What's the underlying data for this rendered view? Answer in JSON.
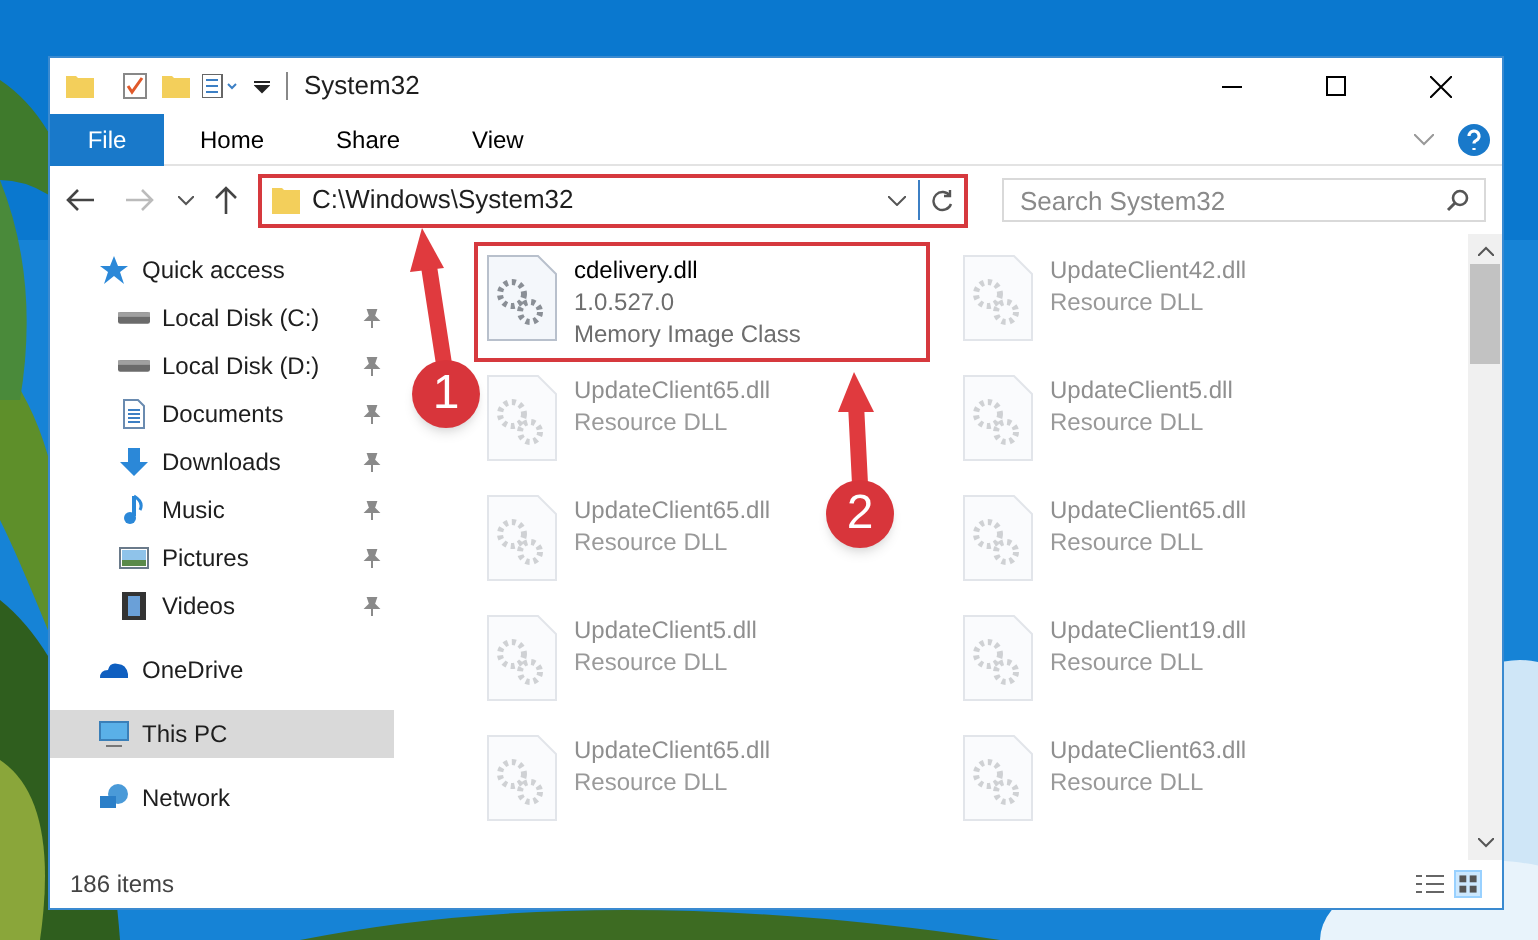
{
  "window": {
    "title": "System32"
  },
  "ribbon": {
    "tabs": [
      {
        "label": "File",
        "selected": true
      },
      {
        "label": "Home",
        "selected": false
      },
      {
        "label": "Share",
        "selected": false
      },
      {
        "label": "View",
        "selected": false
      }
    ]
  },
  "address": {
    "path": "C:\\Windows\\System32",
    "search_placeholder": "Search System32"
  },
  "nav": [
    {
      "label": "Quick access",
      "kind": "star",
      "selected": false,
      "pinned": false,
      "children": [
        {
          "label": "Local Disk (C:)",
          "kind": "drive",
          "selected": false,
          "pinned": true
        },
        {
          "label": "Local Disk (D:)",
          "kind": "drive",
          "selected": false,
          "pinned": true
        },
        {
          "label": "Documents",
          "kind": "document",
          "selected": false,
          "pinned": true
        },
        {
          "label": "Downloads",
          "kind": "download",
          "selected": false,
          "pinned": true
        },
        {
          "label": "Music",
          "kind": "music",
          "selected": false,
          "pinned": true
        },
        {
          "label": "Pictures",
          "kind": "pictures",
          "selected": false,
          "pinned": true
        },
        {
          "label": "Videos",
          "kind": "videos",
          "selected": false,
          "pinned": true
        }
      ]
    },
    {
      "label": "OneDrive",
      "kind": "cloud",
      "selected": false,
      "pinned": false
    },
    {
      "label": "This PC",
      "kind": "pc",
      "selected": true,
      "pinned": false
    },
    {
      "label": "Network",
      "kind": "network",
      "selected": false,
      "pinned": false
    }
  ],
  "files": [
    {
      "name": "cdelivery.dll",
      "lines": [
        "1.0.527.0",
        "Memory Image Class"
      ],
      "highlighted": true,
      "faded": false
    },
    {
      "name": "UpdateClient42.dll",
      "lines": [
        "Resource DLL"
      ],
      "highlighted": false,
      "faded": true
    },
    {
      "name": "UpdateClient65.dll",
      "lines": [
        "Resource DLL"
      ],
      "highlighted": false,
      "faded": true
    },
    {
      "name": "UpdateClient5.dll",
      "lines": [
        "Resource DLL"
      ],
      "highlighted": false,
      "faded": true
    },
    {
      "name": "UpdateClient65.dll",
      "lines": [
        "Resource DLL"
      ],
      "highlighted": false,
      "faded": true
    },
    {
      "name": "UpdateClient65.dll",
      "lines": [
        "Resource DLL"
      ],
      "highlighted": false,
      "faded": true
    },
    {
      "name": "UpdateClient5.dll",
      "lines": [
        "Resource DLL"
      ],
      "highlighted": false,
      "faded": true
    },
    {
      "name": "UpdateClient19.dll",
      "lines": [
        "Resource DLL"
      ],
      "highlighted": false,
      "faded": true
    },
    {
      "name": "UpdateClient65.dll",
      "lines": [
        "Resource DLL"
      ],
      "highlighted": false,
      "faded": true
    },
    {
      "name": "UpdateClient63.dll",
      "lines": [
        "Resource DLL"
      ],
      "highlighted": false,
      "faded": true
    }
  ],
  "status_bar": {
    "count": "186 items"
  },
  "callouts": [
    {
      "label": "1"
    },
    {
      "label": "2"
    }
  ]
}
